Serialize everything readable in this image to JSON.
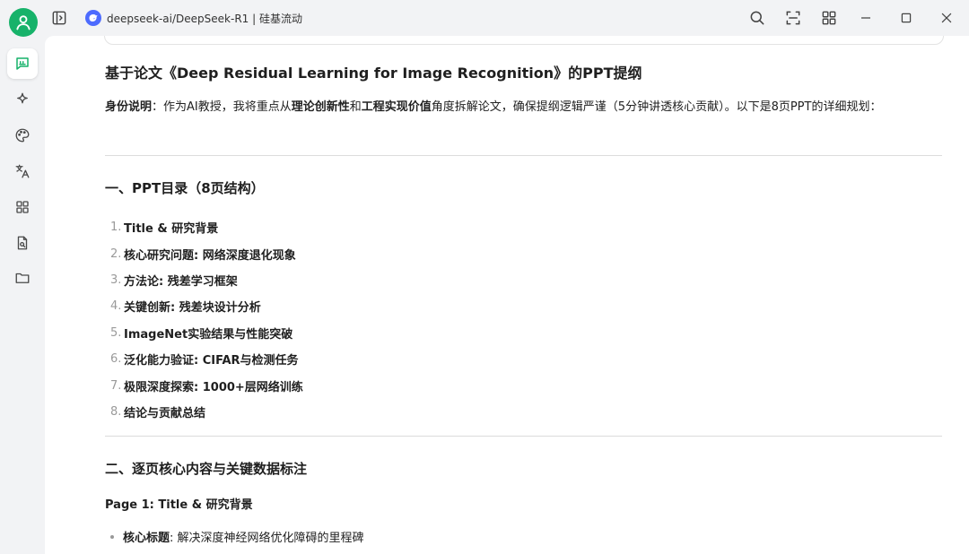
{
  "colors": {
    "accent": "#17b26a",
    "brand_logo": "#4d6bfe"
  },
  "window": {
    "title": "deepseek-ai/DeepSeek-R1 | 硅基流动"
  },
  "rail": {
    "items": [
      {
        "name": "chat-icon",
        "active": true
      },
      {
        "name": "sparkle-icon"
      },
      {
        "name": "palette-icon"
      },
      {
        "name": "translate-icon"
      },
      {
        "name": "apps-grid-icon"
      },
      {
        "name": "document-search-icon"
      },
      {
        "name": "folder-icon"
      }
    ]
  },
  "doc": {
    "title": "基于论文《Deep Residual Learning for Image Recognition》的PPT提纲",
    "intro": {
      "label": "身份说明",
      "t1": "：作为AI教授，我将重点从",
      "b1": "理论创新性",
      "t2": "和",
      "b2": "工程实现价值",
      "t3": "角度拆解论文，确保提纲逻辑严谨（5分钟讲透核心贡献）。以下是8页PPT的详细规划："
    },
    "section1_title": "一、PPT目录（8页结构）",
    "toc": [
      {
        "num": "1.",
        "text": "Title & 研究背景"
      },
      {
        "num": "2.",
        "text": "核心研究问题: 网络深度退化现象"
      },
      {
        "num": "3.",
        "text": "方法论: 残差学习框架"
      },
      {
        "num": "4.",
        "text": "关键创新: 残差块设计分析"
      },
      {
        "num": "5.",
        "text": "ImageNet实验结果与性能突破"
      },
      {
        "num": "6.",
        "text": "泛化能力验证: CIFAR与检测任务"
      },
      {
        "num": "7.",
        "text": "极限深度探索: 1000+层网络训练"
      },
      {
        "num": "8.",
        "text": "结论与贡献总结"
      }
    ],
    "section2_title": "二、逐页核心内容与关键数据标注",
    "page1_heading": "Page 1: Title & 研究背景",
    "bullet1": {
      "label": "核心标题",
      "text": ": 解决深度神经网络优化障碍的里程碑"
    }
  }
}
